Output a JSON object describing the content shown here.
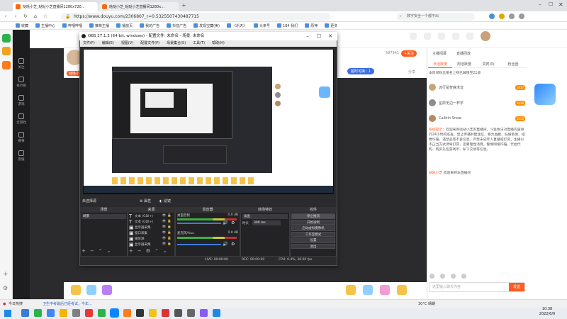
{
  "browser": {
    "tabs": [
      {
        "label": "哒哒小芝_哒哒小芝直播间1280x720..."
      },
      {
        "label": "哒哒小芝_哒哒小芝直播间1280x..."
      }
    ],
    "url": "https://www.douyu.com/2306807_r=0.5325507430487715",
    "search_placeholder": "数字安全一个都不出",
    "bookmarks": [
      {
        "label": "收藏"
      },
      {
        "label": "主播中心"
      },
      {
        "label": "哔哩哔哩"
      },
      {
        "label": "推荐主播"
      },
      {
        "label": "播放页"
      },
      {
        "label": "我的广告"
      },
      {
        "label": "抖音广告"
      },
      {
        "label": "发现宝藏(美)"
      },
      {
        "label": "《乐天》"
      },
      {
        "label": "头条号"
      },
      {
        "label": "184 我们"
      },
      {
        "label": "原神"
      },
      {
        "label": "更多"
      }
    ]
  },
  "douyu_nav": [
    {
      "label": "关注"
    },
    {
      "label": "排行榜"
    },
    {
      "label": "游戏"
    },
    {
      "label": "云游戏"
    },
    {
      "label": "赛事"
    },
    {
      "label": "客服"
    }
  ],
  "stream": {
    "fans": "587941",
    "follow_label": "+关注",
    "streamer_name": "哒哒小芝",
    "badge_label": "超时可换：1",
    "share_label": "分享"
  },
  "chat": {
    "header_items": [
      "主播招募",
      "直播回放"
    ],
    "tabs": [
      "日活跃度",
      "周活跃度",
      "贵宾(0)",
      "粉丝团"
    ],
    "rank_notice": "本房间粉丝排名上榜已解锁至21级",
    "top_users": [
      {
        "name": "远行是梦寐求证",
        "badge": "LV17"
      },
      {
        "name": "星辰无边一杯芋",
        "badge": "LV16"
      },
      {
        "name": "Caiblin Snow",
        "badge": "LV15"
      }
    ],
    "system_tag": "系统提示",
    "system_message": "欢迎来到哒哒小芝的直播间。斗鱼依法对直播内容进行24小时的巡查，禁止传播封建迷信、暴力血腥、低俗色情、招嫖诈骗、违禁品等不良信息。严禁未成年人直播或打赏。主播以不正当方式诱导打赏，还要理性消费。警惕网络诈骗，代他代购、购买礼包游戏币、私下交易等信息。",
    "welcome_name": "哒哒小芝",
    "welcome_text": "欢迎来到本直播间",
    "input_placeholder": "这里输入聊天内容",
    "send_label": "发送"
  },
  "obs": {
    "title": "OBS 27.1.3 (64-bit, windows) - 配置文件: 未命名 - 场景: 未命名",
    "menu": [
      "文件(F)",
      "编辑(E)",
      "视图(V)",
      "配置文件(P)",
      "场景集合(S)",
      "工具(T)",
      "帮助(H)"
    ],
    "scene_bar": "未选择源",
    "toolbar": {
      "properties": "属性",
      "filters": "滤镜"
    },
    "docks": {
      "scenes": "场景",
      "sources": "来源",
      "mixer": "混音器",
      "transitions": "转场特效",
      "controls": "控件"
    },
    "scene_items": [
      "场景"
    ],
    "source_items": [
      "文本 (GDI+)",
      "文本 (GDI+)",
      "显示器采集",
      "窗口采集",
      "媒体源",
      "显示器采集"
    ],
    "mixer": {
      "desktop_label": "桌面音频",
      "desktop_db": "0.0 dB",
      "mic_label": "麦克风/Aux",
      "mic_db": "0.0 dB"
    },
    "transition": {
      "type": "淡出",
      "duration_label": "时长",
      "duration_value": "300 ms"
    },
    "controls": [
      "停止推流",
      "开始录制",
      "启动虚拟摄像机",
      "工作室模式",
      "设置",
      "退出"
    ],
    "status": {
      "live": "LIVE: 00:00:00",
      "rec": "REC: 00:00:00",
      "cpu": "CPU: 0.4%, 30.00 fps"
    }
  },
  "taskbar": {
    "news": "今日热搜",
    "news_text": "卫生中考最后已经考试，今年...",
    "weather": "30°C 晴朗",
    "time": "10:38",
    "date": "2022/6/9"
  },
  "colors": {
    "accent": "#ff5d23",
    "obs_bg": "#2b2b2d",
    "douyu_nav": "#1d1d1f"
  }
}
